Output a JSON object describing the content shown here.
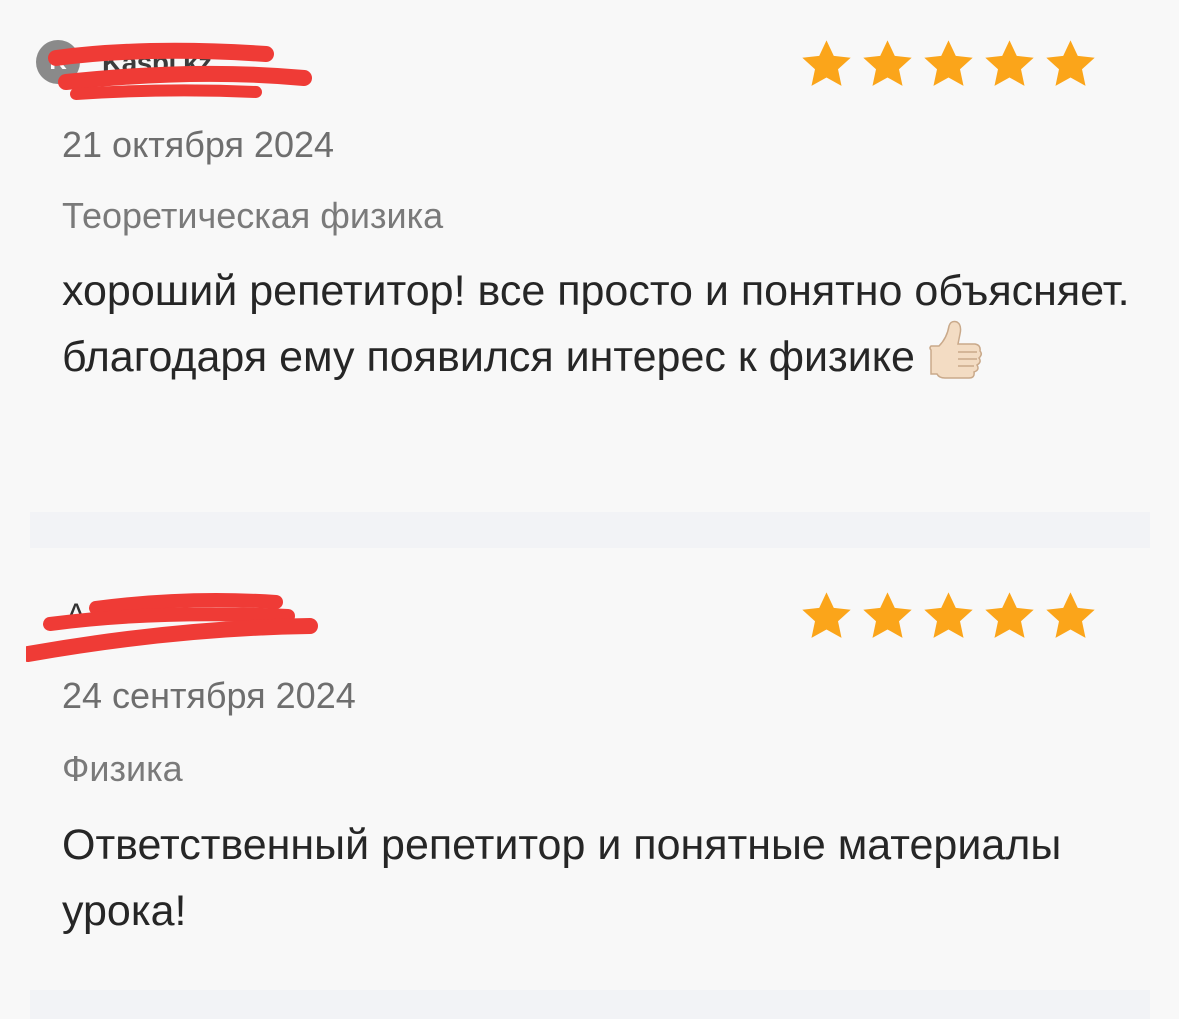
{
  "reviews": [
    {
      "logo_text": "Kaspi.kz",
      "logo_letter": "K",
      "name_initial": "",
      "rating": 5,
      "date": "21 октября 2024",
      "subject": "Теоретическая физика",
      "text": "хороший репетитор! все просто и понятно объясняет. благодаря ему появился интерес к физике",
      "emoji": "thumbs-up"
    },
    {
      "logo_text": "",
      "logo_letter": "",
      "name_initial": "А",
      "rating": 5,
      "date": "24 сентября 2024",
      "subject": "Физика",
      "text": "Ответственный репетитор и понятные материалы урока!",
      "emoji": ""
    }
  ],
  "colors": {
    "star": "#fba51a",
    "redaction": "#ef3b36",
    "background": "#f8f8f8",
    "separator": "#f2f3f6"
  }
}
